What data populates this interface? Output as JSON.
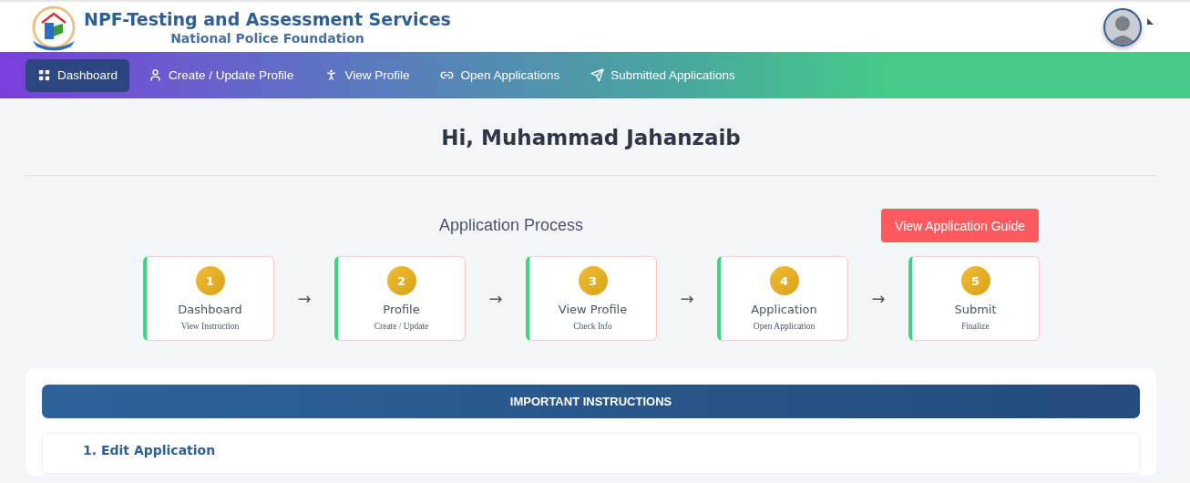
{
  "header": {
    "title": "NPF-Testing and Assessment Services",
    "subtitle": "National Police Foundation"
  },
  "nav": [
    {
      "label": "Dashboard",
      "kind": "grid",
      "selected": true
    },
    {
      "label": "Create / Update Profile",
      "kind": "user",
      "selected": false
    },
    {
      "label": "View Profile",
      "kind": "person",
      "selected": false
    },
    {
      "label": "Open Applications",
      "kind": "link",
      "selected": false
    },
    {
      "label": "Submitted Applications",
      "kind": "send",
      "selected": false
    }
  ],
  "greeting": "Hi, Muhammad Jahanzaib",
  "process": {
    "title": "Application Process",
    "guide_button": "View Application Guide",
    "steps": [
      {
        "number": "1",
        "title": "Dashboard",
        "caption": "View Instruction"
      },
      {
        "number": "2",
        "title": "Profile",
        "caption": "Create / Update"
      },
      {
        "number": "3",
        "title": "View Profile",
        "caption": "Check Info"
      },
      {
        "number": "4",
        "title": "Application",
        "caption": "Open Application"
      },
      {
        "number": "5",
        "title": "Submit",
        "caption": "Finalize"
      }
    ],
    "arrow": "→"
  },
  "instructions": {
    "title": "IMPORTANT INSTRUCTIONS",
    "items": [
      {
        "heading": "1. Edit Application"
      }
    ]
  }
}
